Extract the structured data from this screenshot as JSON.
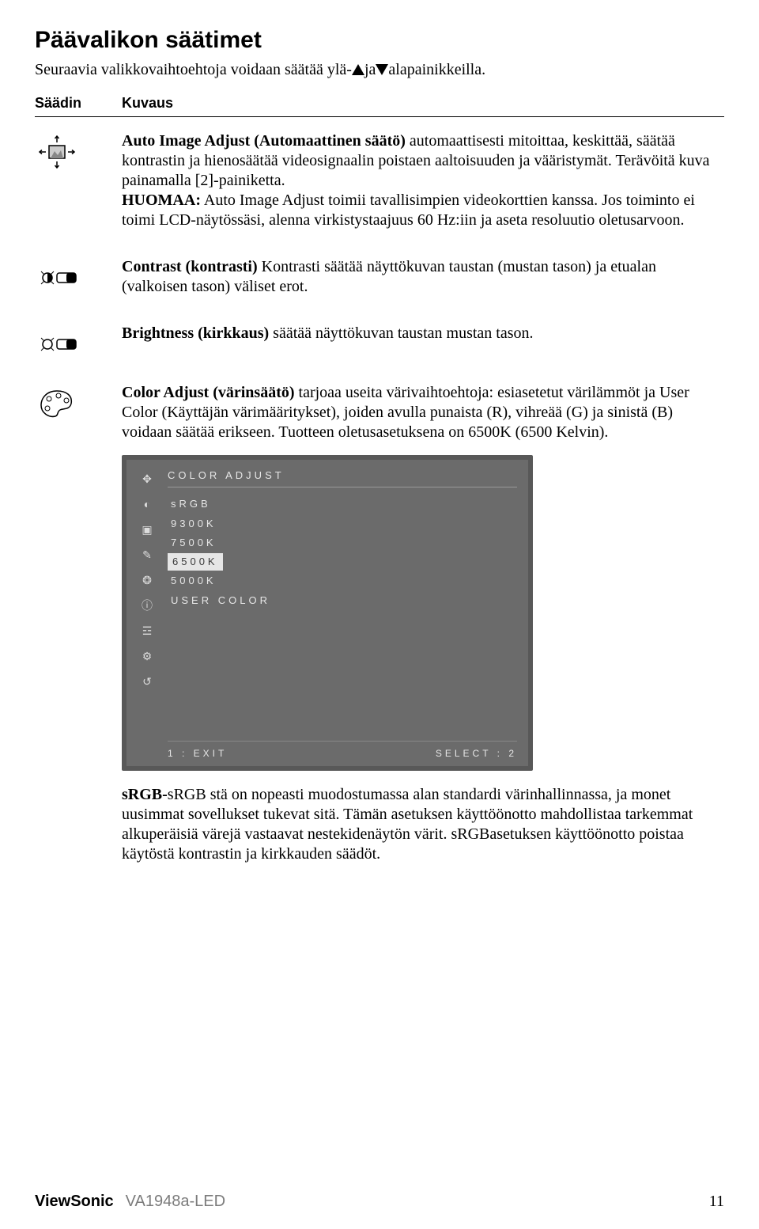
{
  "title": "Päävalikon säätimet",
  "intro_pre": "Seuraavia valikkovaihtoehtoja voidaan säätää ylä-",
  "intro_mid": "ja",
  "intro_post": "alapainikkeilla.",
  "table": {
    "head_control": "Säädin",
    "head_desc": "Kuvaus"
  },
  "rows": {
    "auto": {
      "bold": "Auto Image Adjust (Automaattinen säätö)",
      "t1": " automaattisesti mitoittaa, keskittää, säätää kontrastin ja hienosäätää videosignaalin poistaen aaltoisuuden ja vääristymät. Terävöitä kuva painamalla [2]-painiketta.",
      "note_b": "HUOMAA:",
      "note_t": " Auto Image Adjust toimii tavallisimpien videokorttien kanssa. Jos toiminto ei toimi LCD-näytössäsi, alenna virkistystaajuus 60 Hz:iin ja aseta resoluutio oletusarvoon."
    },
    "contrast": {
      "bold": "Contrast (kontrasti)",
      "t": " Kontrasti säätää näyttökuvan taustan (mustan tason) ja etualan (valkoisen tason) väliset erot."
    },
    "brightness": {
      "bold": "Brightness (kirkkaus)",
      "t": " säätää näyttökuvan taustan mustan tason."
    },
    "color": {
      "bold": "Color Adjust (värinsäätö)",
      "t": " tarjoaa useita värivaihtoehtoja: esiasetetut värilämmöt ja User Color (Käyttäjän värimääritykset), joiden avulla punaista (R), vihreää (G) ja sinistä (B) voidaan säätää erikseen. Tuotteen oletusasetuksena on 6500K (6500 Kelvin)."
    },
    "srgb": {
      "bold": "sRGB-",
      "t": "sRGB stä on nopeasti muodostumassa alan standardi värinhallinnassa, ja monet uusimmat sovellukset tukevat sitä. Tämän asetuksen käyttöönotto mahdollistaa tarkemmat alkuperäisiä värejä vastaavat nestekidenäytön värit. sRGBasetuksen käyttöönotto poistaa käytöstä kontrastin ja kirkkauden säädöt."
    }
  },
  "osd": {
    "title": "COLOR ADJUST",
    "items": [
      "sRGB",
      "9300K",
      "7500K",
      "6500K",
      "5000K",
      "USER COLOR"
    ],
    "selected_index": 3,
    "footer_left": "1 : EXIT",
    "footer_right": "SELECT : 2"
  },
  "footer": {
    "brand": "ViewSonic",
    "model": "VA1948a-LED",
    "page": "11"
  }
}
